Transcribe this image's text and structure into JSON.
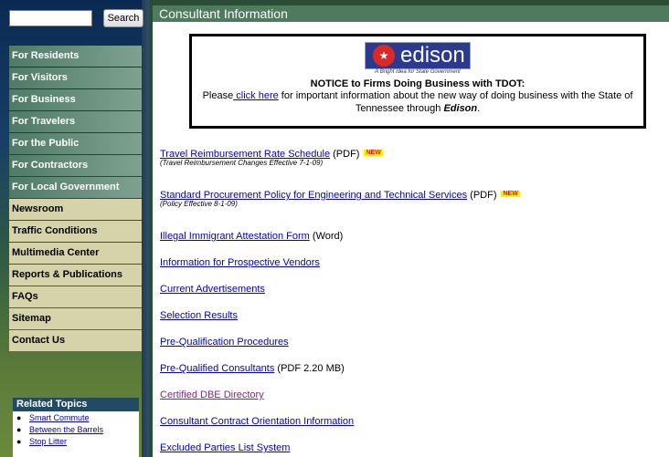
{
  "search": {
    "placeholder": "",
    "value": "",
    "button_label": "Search"
  },
  "nav": [
    {
      "label": "For Residents",
      "style": "green"
    },
    {
      "label": "For Visitors",
      "style": "green"
    },
    {
      "label": "For Business",
      "style": "green"
    },
    {
      "label": "For Travelers",
      "style": "green"
    },
    {
      "label": "For the Public",
      "style": "green"
    },
    {
      "label": "For Contractors",
      "style": "green"
    },
    {
      "label": "For Local Government",
      "style": "green"
    },
    {
      "label": "Newsroom",
      "style": "tan"
    },
    {
      "label": "Traffic Conditions",
      "style": "tan"
    },
    {
      "label": "Multimedia Center",
      "style": "tan"
    },
    {
      "label": "Reports & Publications",
      "style": "tan"
    },
    {
      "label": "FAQs",
      "style": "tan"
    },
    {
      "label": "Sitemap",
      "style": "tan"
    },
    {
      "label": "Contact Us",
      "style": "tan"
    }
  ],
  "related": {
    "heading": "Related Topics",
    "items": [
      "Smart Commute",
      "Between the Barrels",
      "Stop Litter"
    ]
  },
  "main": {
    "title": "Consultant Information",
    "notice": {
      "logo_text": "edison",
      "logo_tagline": "A Bright Idea for State Government",
      "heading": "NOTICE to Firms Doing Business with TDOT:",
      "body_before": "Please",
      "body_link": " click here",
      "body_after": " for important information about the new way of doing business with the State of Tennessee through ",
      "body_emph": "Edison",
      "body_end": "."
    },
    "links": [
      {
        "text": "Travel Reimbursement Rate Schedule",
        "extra": " (PDF)",
        "new": "NEW",
        "note": "(Travel Reimbursement Changes Effective 7-1-09)",
        "visited": false
      },
      {
        "text": "Standard Procurement Policy for Engineering and Technical Services",
        "extra": " (PDF)",
        "new": "NEW",
        "note": "(Policy Effective 8-1-09)",
        "visited": false
      },
      {
        "text": "Illegal Immigrant Attestation Form",
        "extra": " (Word)",
        "new": "",
        "note": "",
        "visited": false
      },
      {
        "text": "Information for Prospective Vendors",
        "extra": "",
        "new": "",
        "note": "",
        "visited": false
      },
      {
        "text": "Current Advertisements",
        "extra": "",
        "new": "",
        "note": "",
        "visited": false
      },
      {
        "text": "Selection Results",
        "extra": "",
        "new": "",
        "note": "",
        "visited": false
      },
      {
        "text": "Pre-Qualification Procedures",
        "extra": "",
        "new": "",
        "note": "",
        "visited": false
      },
      {
        "text": "Pre-Qualified Consultants",
        "extra": " (PDF 2.20 MB)",
        "new": "",
        "note": "",
        "visited": false
      },
      {
        "text": "Certified DBE Directory",
        "extra": "",
        "new": "",
        "note": "",
        "visited": true
      },
      {
        "text": "Consultant Contract Orientation Information",
        "extra": "",
        "new": "",
        "note": "",
        "visited": false
      },
      {
        "text": "Excluded Parties List System",
        "extra": "",
        "new": "",
        "note": "",
        "visited": false
      }
    ]
  },
  "colors": {
    "title_bar": "#4e7a5e",
    "nav_green": "#4f7a68",
    "nav_tan": "#d6d3aa",
    "link": "#0000cc",
    "visited_link": "#7a2a7a",
    "new_badge_bg": "#ffef00",
    "new_badge_text": "#e31b1b"
  }
}
